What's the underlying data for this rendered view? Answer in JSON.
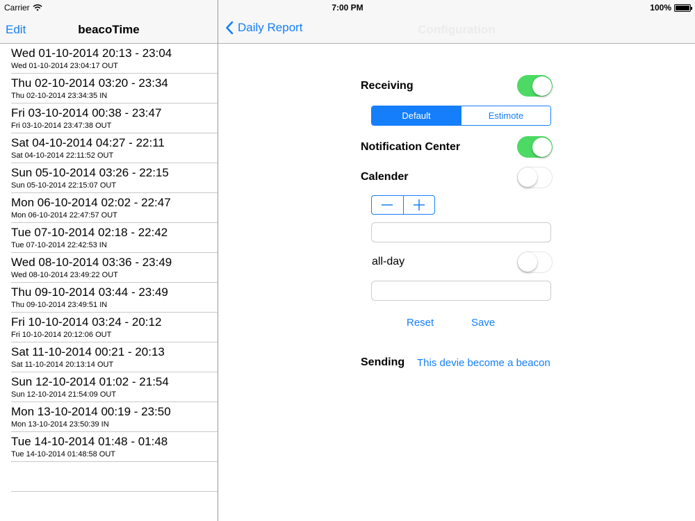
{
  "status_bar": {
    "carrier": "Carrier",
    "time": "7:00 PM",
    "battery": "100%"
  },
  "master": {
    "edit_label": "Edit",
    "title": "beacoTime",
    "items": [
      {
        "title": "Wed 01-10-2014 20:13 - 23:04",
        "subtitle": "Wed 01-10-2014 23:04:17 OUT"
      },
      {
        "title": "Thu 02-10-2014 03:20 - 23:34",
        "subtitle": "Thu 02-10-2014 23:34:35 IN"
      },
      {
        "title": "Fri 03-10-2014 00:38 - 23:47",
        "subtitle": "Fri 03-10-2014 23:47:38 OUT"
      },
      {
        "title": "Sat 04-10-2014 04:27 - 22:11",
        "subtitle": "Sat 04-10-2014 22:11:52 OUT"
      },
      {
        "title": "Sun 05-10-2014 03:26 - 22:15",
        "subtitle": "Sun 05-10-2014 22:15:07 OUT"
      },
      {
        "title": "Mon 06-10-2014 02:02 - 22:47",
        "subtitle": "Mon 06-10-2014 22:47:57 OUT"
      },
      {
        "title": "Tue 07-10-2014 02:18 - 22:42",
        "subtitle": "Tue 07-10-2014 22:42:53 IN"
      },
      {
        "title": "Wed 08-10-2014 03:36 - 23:49",
        "subtitle": "Wed 08-10-2014 23:49:22 OUT"
      },
      {
        "title": "Thu 09-10-2014 03:44 - 23:49",
        "subtitle": "Thu 09-10-2014 23:49:51 IN"
      },
      {
        "title": "Fri 10-10-2014 03:24 - 20:12",
        "subtitle": "Fri 10-10-2014 20:12:06 OUT"
      },
      {
        "title": "Sat 11-10-2014 00:21 - 20:13",
        "subtitle": "Sat 11-10-2014 20:13:14 OUT"
      },
      {
        "title": "Sun 12-10-2014 01:02 - 21:54",
        "subtitle": "Sun 12-10-2014 21:54:09 OUT"
      },
      {
        "title": "Mon 13-10-2014 00:19 - 23:50",
        "subtitle": "Mon 13-10-2014 23:50:39 IN"
      },
      {
        "title": "Tue 14-10-2014 01:48 - 01:48",
        "subtitle": "Tue 14-10-2014 01:48:58 OUT"
      }
    ]
  },
  "detail": {
    "back_label": "Daily Report",
    "title": "Configuration",
    "receiving": {
      "label": "Receiving",
      "on": true
    },
    "segments": {
      "options": [
        "Default",
        "Estimote"
      ],
      "selected": "Default"
    },
    "notification_center": {
      "label": "Notification Center",
      "on": true
    },
    "calender": {
      "label": "Calender",
      "on": false
    },
    "field1": {
      "value": "",
      "placeholder": ""
    },
    "all_day": {
      "label": "all-day",
      "on": false
    },
    "field2": {
      "value": "",
      "placeholder": ""
    },
    "reset_label": "Reset",
    "save_label": "Save",
    "sending": {
      "label": "Sending",
      "action_label": "This devie become a beacon"
    }
  },
  "colors": {
    "accent": "#147efb",
    "toggle_on": "#4cd964",
    "nav_bg": "#f7f7f7"
  },
  "icons": [
    "wifi-icon",
    "battery-icon",
    "back-chevron-icon",
    "minus-icon",
    "plus-icon"
  ]
}
